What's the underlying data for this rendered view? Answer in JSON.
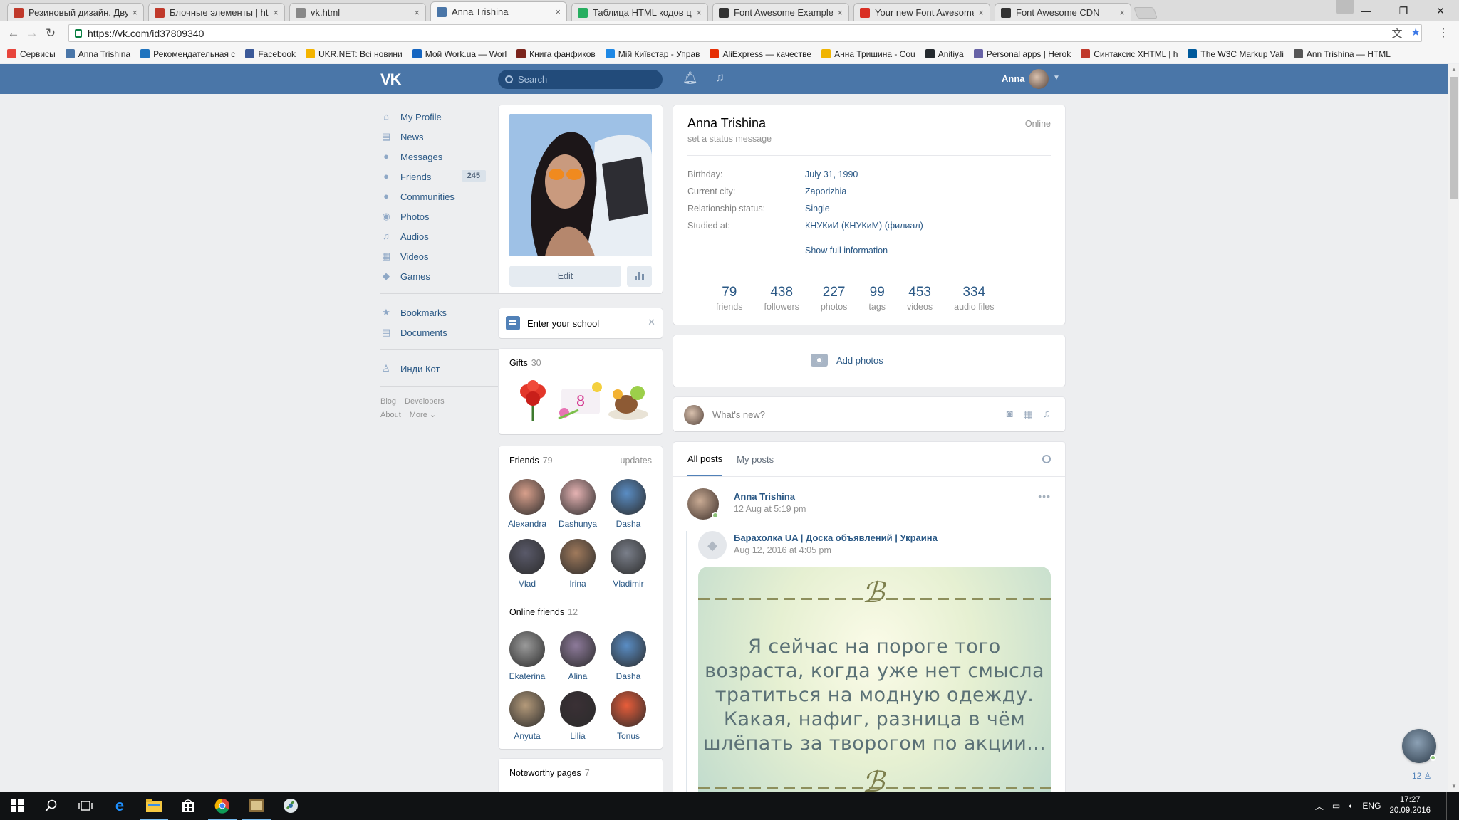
{
  "browser": {
    "tabs": [
      {
        "label": "Резиновый дизайн. Дву",
        "color": "#c0392b"
      },
      {
        "label": "Блочные элементы | htm",
        "color": "#c0392b"
      },
      {
        "label": "vk.html",
        "color": "#888888"
      },
      {
        "label": "Anna Trishina",
        "color": "#4a76a8",
        "active": true
      },
      {
        "label": "Таблица HTML кодов цв",
        "color": "#27ae60"
      },
      {
        "label": "Font Awesome Examples",
        "color": "#333333"
      },
      {
        "label": "Your new Font Awesome",
        "color": "#d93025"
      },
      {
        "label": "Font Awesome CDN",
        "color": "#333333"
      }
    ],
    "tab_close": "×",
    "window_controls": {
      "minimize": "—",
      "restore": "❐",
      "close": "✕"
    },
    "nav": {
      "back": "←",
      "forward": "→",
      "reload": "↻"
    },
    "url": "https://vk.com/id37809340",
    "star": "★",
    "translate": "文",
    "menu": "⋮",
    "bookmarks": [
      {
        "label": "Сервисы",
        "color": "#e8453c"
      },
      {
        "label": "Anna Trishina",
        "color": "#4a76a8"
      },
      {
        "label": "Рекомендательная с",
        "color": "#1e73be"
      },
      {
        "label": "Facebook",
        "color": "#3b5998"
      },
      {
        "label": "UKR.NET: Всі новини",
        "color": "#f4b400"
      },
      {
        "label": "Мой Work.ua — Worl",
        "color": "#1565c0"
      },
      {
        "label": "Книга фанфиков",
        "color": "#7b241c"
      },
      {
        "label": "Мій Київстар - Управ",
        "color": "#1e88e5"
      },
      {
        "label": "AliExpress — качестве",
        "color": "#e62e04"
      },
      {
        "label": "Анна Тришина - Cou",
        "color": "#f0b400"
      },
      {
        "label": "Anitiya",
        "color": "#24292e"
      },
      {
        "label": "Personal apps | Herok",
        "color": "#6762a6"
      },
      {
        "label": "Синтаксис XHTML | h",
        "color": "#c0392b"
      },
      {
        "label": "The W3C Markup Vali",
        "color": "#005a9c"
      },
      {
        "label": "Ann Trishina — HTML",
        "color": "#555555"
      }
    ]
  },
  "vk": {
    "logo": "VK",
    "search_placeholder": "Search",
    "user_name": "Anna",
    "left_menu": [
      {
        "label": "My Profile",
        "icon": "⌂",
        "name": "home-icon"
      },
      {
        "label": "News",
        "icon": "▤",
        "name": "news-icon"
      },
      {
        "label": "Messages",
        "icon": "●",
        "name": "messages-icon"
      },
      {
        "label": "Friends",
        "icon": "●",
        "name": "friends-icon",
        "count": "245"
      },
      {
        "label": "Communities",
        "icon": "●",
        "name": "communities-icon"
      },
      {
        "label": "Photos",
        "icon": "◉",
        "name": "photos-icon"
      },
      {
        "label": "Audios",
        "icon": "♫",
        "name": "audios-icon"
      },
      {
        "label": "Videos",
        "icon": "▦",
        "name": "videos-icon"
      },
      {
        "label": "Games",
        "icon": "◆",
        "name": "games-icon"
      }
    ],
    "left_menu_2": [
      {
        "label": "Bookmarks",
        "icon": "★",
        "name": "bookmarks-icon"
      },
      {
        "label": "Documents",
        "icon": "▤",
        "name": "documents-icon"
      }
    ],
    "left_menu_3": [
      {
        "label": "Инди Кот",
        "icon": "♙",
        "name": "app-icon"
      }
    ],
    "footer": {
      "blog": "Blog",
      "developers": "Developers",
      "about": "About",
      "more": "More ⌄"
    },
    "profile": {
      "edit": "Edit",
      "school_prompt": "Enter your school",
      "gifts_title": "Gifts",
      "gifts_count": "30",
      "friends_title": "Friends",
      "friends_count": "79",
      "friends_updates": "updates",
      "friends": [
        {
          "name": "Alexandra",
          "color": "#d9a08c"
        },
        {
          "name": "Dashunya",
          "color": "#e6b3b3"
        },
        {
          "name": "Dasha",
          "color": "#5a8dc4"
        },
        {
          "name": "Vlad",
          "color": "#5a5a6a"
        },
        {
          "name": "Irina",
          "color": "#a07a5c"
        },
        {
          "name": "Vladimir",
          "color": "#7a7f8a"
        }
      ],
      "online_title": "Online friends",
      "online_count": "12",
      "online_friends": [
        {
          "name": "Ekaterina",
          "color": "#9a9a9a"
        },
        {
          "name": "Alina",
          "color": "#8d7a9a"
        },
        {
          "name": "Dasha",
          "color": "#5a8dc4"
        },
        {
          "name": "Anyuta",
          "color": "#b49a7a"
        },
        {
          "name": "Lilia",
          "color": "#3a3035"
        },
        {
          "name": "Tonus",
          "color": "#e85d3a"
        }
      ],
      "noteworthy_title": "Noteworthy pages",
      "noteworthy_count": "7",
      "name": "Anna Trishina",
      "status": "set a status message",
      "online": "Online",
      "info": [
        {
          "label": "Birthday:",
          "value": "July 31, 1990"
        },
        {
          "label": "Current city:",
          "value": "Zaporizhia"
        },
        {
          "label": "Relationship status:",
          "value": "Single"
        },
        {
          "label": "Studied at:",
          "value": "КНУКиИ (КНУКиМ) (филиал)"
        }
      ],
      "show_full": "Show full information",
      "counters": [
        {
          "value": "79",
          "label": "friends"
        },
        {
          "value": "438",
          "label": "followers"
        },
        {
          "value": "227",
          "label": "photos"
        },
        {
          "value": "99",
          "label": "tags"
        },
        {
          "value": "453",
          "label": "videos"
        },
        {
          "value": "334",
          "label": "audio files"
        }
      ],
      "add_photos": "Add photos",
      "whats_new": "What's new?"
    },
    "wall": {
      "tab_all": "All posts",
      "tab_mine": "My posts",
      "post_author": "Anna Trishina",
      "post_date": "12 Aug at 5:19 pm",
      "post_more": "•••",
      "repost_author": "Барахолка UA | Доска объявлений | Украина",
      "repost_date": "Aug 12, 2016 at 4:05 pm",
      "quote_ornament": "ℬ",
      "quote_text": "Я сейчас на пороге того возраста, когда уже нет смысла тратиться на модную одежду. Какая, нафиг, разница в чём шлёпать за творогом по акции..."
    },
    "chat_count": "12 ♙"
  },
  "taskbar": {
    "lang": "ENG",
    "time": "17:27",
    "date": "20.09.2016"
  }
}
